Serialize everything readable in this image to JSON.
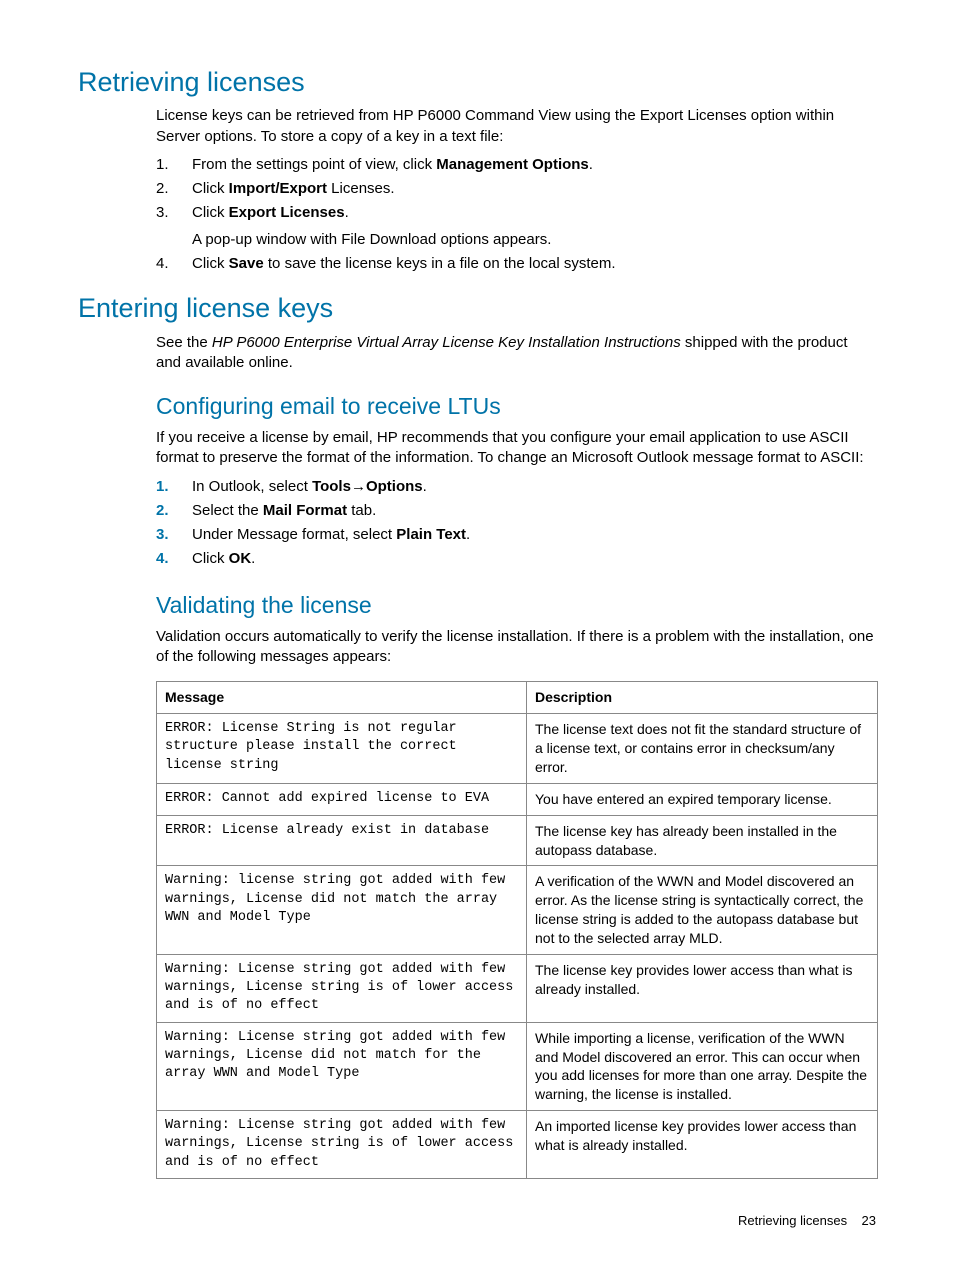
{
  "headings": {
    "retrieving": "Retrieving licenses",
    "entering": "Entering license keys",
    "configuring": "Configuring email to receive LTUs",
    "validating": "Validating the license"
  },
  "retrieving_intro": "License keys can be retrieved from HP P6000 Command View using the Export Licenses option within Server options. To store a copy of a key in a text file:",
  "retrieving_steps": {
    "s1a": "From the settings point of view, click ",
    "s1b": "Management Options",
    "s1c": ".",
    "s2a": "Click ",
    "s2b": "Import/Export",
    "s2c": " Licenses.",
    "s3a": "Click ",
    "s3b": "Export Licenses",
    "s3c": ".",
    "s3sub": "A pop-up window with File Download options appears.",
    "s4a": "Click ",
    "s4b": "Save",
    "s4c": " to save the license keys in a file on the local system."
  },
  "entering_text": {
    "a": "See the ",
    "b": "HP P6000 Enterprise Virtual Array License Key Installation Instructions",
    "c": " shipped with the product and available online."
  },
  "configuring_intro": "If you receive a license by email, HP recommends that you configure your email application to use ASCII format to preserve the format of the information. To change an Microsoft Outlook message format to ASCII:",
  "configuring_steps": {
    "s1a": "In Outlook, select ",
    "s1b": "Tools",
    "s1c": "→",
    "s1d": "Options",
    "s1e": ".",
    "s2a": "Select the ",
    "s2b": "Mail Format",
    "s2c": " tab.",
    "s3a": "Under Message format, select ",
    "s3b": "Plain Text",
    "s3c": ".",
    "s4a": "Click ",
    "s4b": "OK",
    "s4c": "."
  },
  "validating_intro": "Validation occurs automatically to verify the license installation. If there is a problem with the installation, one of the following messages appears:",
  "table": {
    "headers": {
      "message": "Message",
      "description": "Description"
    },
    "rows": [
      {
        "message": "ERROR: License String is not regular structure please install the correct license string",
        "description": "The license text does not fit the standard structure of a license text, or contains error in checksum/any error."
      },
      {
        "message": "ERROR: Cannot add expired license to EVA",
        "description": "You have entered an expired temporary license."
      },
      {
        "message": "ERROR: License already exist in database",
        "description": "The license key has already been installed in the autopass database."
      },
      {
        "message": "Warning: license string got added with few warnings, License did not match the array WWN and Model Type",
        "description": "A verification of the WWN and Model discovered an error. As the license string is syntactically correct, the license string is added to the autopass database but not to the selected array MLD."
      },
      {
        "message": "Warning: License string got added with few warnings, License string is of lower access and is of no effect",
        "description": "The license key provides lower access than what is already installed."
      },
      {
        "message": "Warning: License string got added with few warnings, License did not match for the array WWN and Model Type",
        "description": "While importing a license, verification of the WWN and Model discovered an error. This can occur when you add licenses for more than one array. Despite the warning, the license is installed."
      },
      {
        "message": "Warning: License string got added with few warnings, License string is of lower access and is of no effect",
        "description": "An imported license key provides lower access than what is already installed."
      }
    ]
  },
  "footer": {
    "section": "Retrieving licenses",
    "page": "23"
  }
}
